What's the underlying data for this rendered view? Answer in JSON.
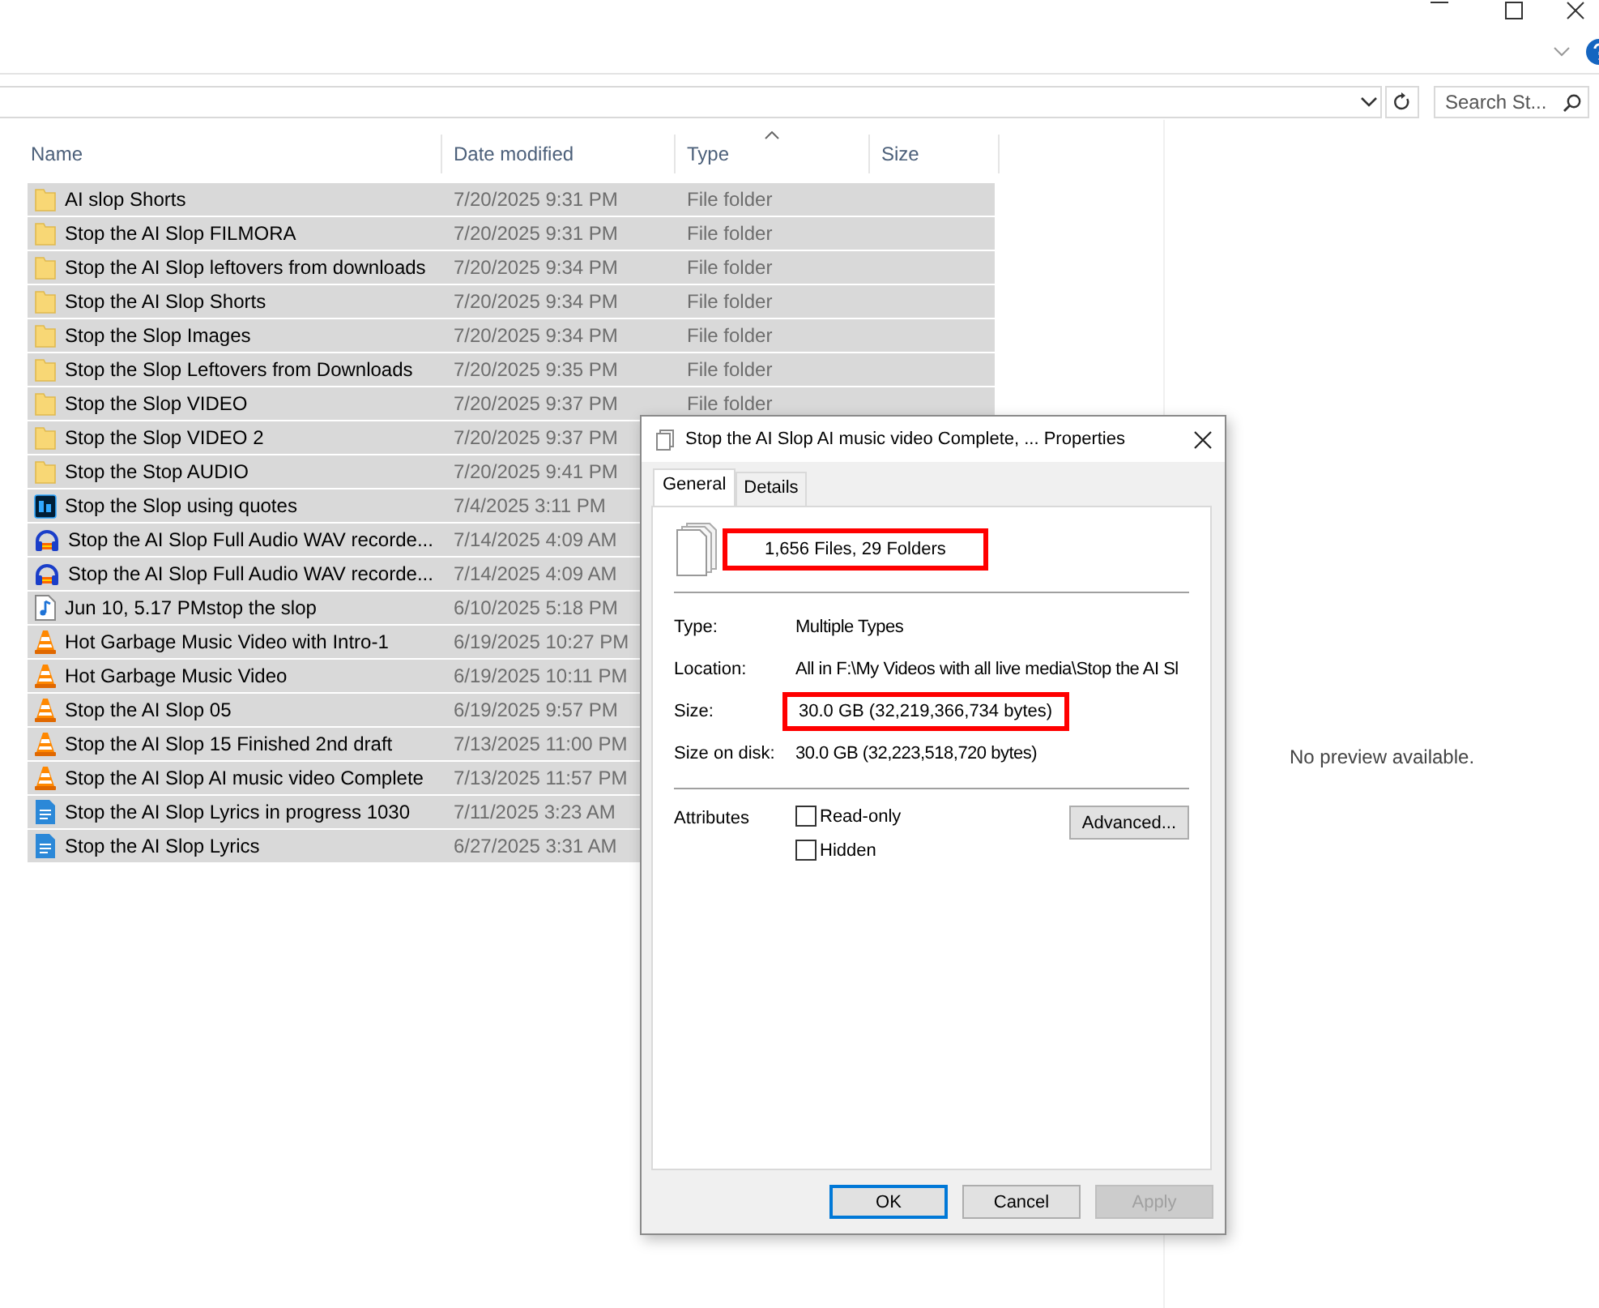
{
  "search": {
    "placeholder": "Search St..."
  },
  "columns": [
    {
      "label": "Name",
      "sorted": false
    },
    {
      "label": "Date modified",
      "sorted": false
    },
    {
      "label": "Type",
      "sorted": true
    },
    {
      "label": "Size",
      "sorted": false
    }
  ],
  "rows": [
    {
      "name": "AI slop Shorts",
      "date": "7/20/2025 9:31 PM",
      "type": "File folder",
      "kind": "folder",
      "selected": true
    },
    {
      "name": "Stop the AI Slop FILMORA",
      "date": "7/20/2025 9:31 PM",
      "type": "File folder",
      "kind": "folder",
      "selected": true
    },
    {
      "name": "Stop the AI Slop leftovers from downloads",
      "date": "7/20/2025 9:34 PM",
      "type": "File folder",
      "kind": "folder",
      "selected": true
    },
    {
      "name": "Stop the AI Slop Shorts",
      "date": "7/20/2025 9:34 PM",
      "type": "File folder",
      "kind": "folder",
      "selected": true
    },
    {
      "name": "Stop the Slop Images",
      "date": "7/20/2025 9:34 PM",
      "type": "File folder",
      "kind": "folder",
      "selected": true
    },
    {
      "name": "Stop the Slop Leftovers  from Downloads",
      "date": "7/20/2025 9:35 PM",
      "type": "File folder",
      "kind": "folder",
      "selected": true
    },
    {
      "name": "Stop the Slop VIDEO",
      "date": "7/20/2025 9:37 PM",
      "type": "File folder",
      "kind": "folder",
      "selected": true
    },
    {
      "name": "Stop the Slop VIDEO 2",
      "date": "7/20/2025 9:37 PM",
      "kind": "folder",
      "selected": true
    },
    {
      "name": "Stop the Stop AUDIO",
      "date": "7/20/2025 9:41 PM",
      "kind": "folder",
      "selected": true
    },
    {
      "name": "Stop the Slop using quotes",
      "date": "7/4/2025 3:11 PM",
      "kind": "image-editor",
      "selected": true
    },
    {
      "name": "Stop the AI Slop Full Audio WAV recorde...",
      "date": "7/14/2025 4:09 AM",
      "kind": "audio",
      "selected": true
    },
    {
      "name": "Stop the AI Slop Full Audio WAV recorde...",
      "date": "7/14/2025 4:09 AM",
      "kind": "audio",
      "selected": true
    },
    {
      "name": "Jun 10, 5.17 PMstop the slop",
      "date": "6/10/2025 5:18 PM",
      "kind": "music",
      "selected": true
    },
    {
      "name": "Hot Garbage Music Video with Intro-1",
      "date": "6/19/2025 10:27 PM",
      "kind": "video",
      "selected": true
    },
    {
      "name": "Hot Garbage Music Video",
      "date": "6/19/2025 10:11 PM",
      "kind": "video",
      "selected": true
    },
    {
      "name": "Stop the AI Slop 05",
      "date": "6/19/2025 9:57 PM",
      "kind": "video",
      "selected": true
    },
    {
      "name": "Stop the AI Slop 15 Finished 2nd draft",
      "date": "7/13/2025 11:00 PM",
      "kind": "video",
      "selected": true
    },
    {
      "name": "Stop the AI Slop AI music video Complete",
      "date": "7/13/2025 11:57 PM",
      "kind": "video",
      "selected": true
    },
    {
      "name": "Stop the AI Slop Lyrics in progress 1030",
      "date": "7/11/2025 3:23 AM",
      "kind": "document",
      "selected": true
    },
    {
      "name": "Stop the AI Slop Lyrics",
      "date": "6/27/2025 3:31 AM",
      "kind": "document",
      "selected": true
    }
  ],
  "preview": {
    "message": "No preview available."
  },
  "dialog": {
    "title": "Stop the AI Slop AI music video Complete, ... Properties",
    "tabs": [
      {
        "label": "General",
        "selected": true
      },
      {
        "label": "Details",
        "selected": false
      }
    ],
    "summary": {
      "text": "1,656 Files, 29 Folders",
      "highlighted": true
    },
    "properties": [
      {
        "label": "Type:",
        "value": "Multiple Types",
        "highlighted": false
      },
      {
        "label": "Location:",
        "value": "All in F:\\My Videos with all live media\\Stop the AI Sl",
        "highlighted": false
      },
      {
        "label": "Size:",
        "value": "30.0 GB (32,219,366,734 bytes)",
        "highlighted": true
      },
      {
        "label": "Size on disk:",
        "value": "30.0 GB (32,223,518,720 bytes)",
        "highlighted": false
      }
    ],
    "attributes": {
      "label": "Attributes",
      "checkboxes": [
        {
          "label": "Read-only",
          "checked": false
        },
        {
          "label": "Hidden",
          "checked": false
        }
      ],
      "advanced_button": "Advanced..."
    },
    "buttons": [
      {
        "label": "OK",
        "default": true,
        "disabled": false
      },
      {
        "label": "Cancel",
        "default": false,
        "disabled": false
      },
      {
        "label": "Apply",
        "default": false,
        "disabled": true
      }
    ]
  }
}
